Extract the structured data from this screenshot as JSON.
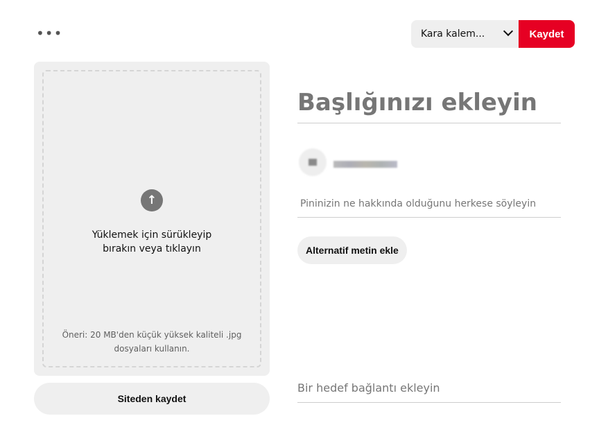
{
  "toolbar": {
    "more_label": "•••",
    "board_select": "Kara kalem...",
    "save_label": "Kaydet"
  },
  "upload": {
    "icon": "arrow-up-icon",
    "text_line1": "Yüklemek için sürükleyip",
    "text_line2": "bırakın veya tıklayın",
    "hint_line1": "Öneri: 20 MB'den küçük yüksek kaliteli .jpg",
    "hint_line2": "dosyaları kullanın."
  },
  "site_save_label": "Siteden kaydet",
  "form": {
    "title_placeholder": "Başlığınızı ekleyin",
    "description_placeholder": "Pininizin ne hakkında olduğunu herkese söyleyin",
    "alt_text_button": "Alternatif metin ekle",
    "link_placeholder": "Bir hedef bağlantı ekleyin"
  },
  "colors": {
    "accent": "#e60023"
  }
}
